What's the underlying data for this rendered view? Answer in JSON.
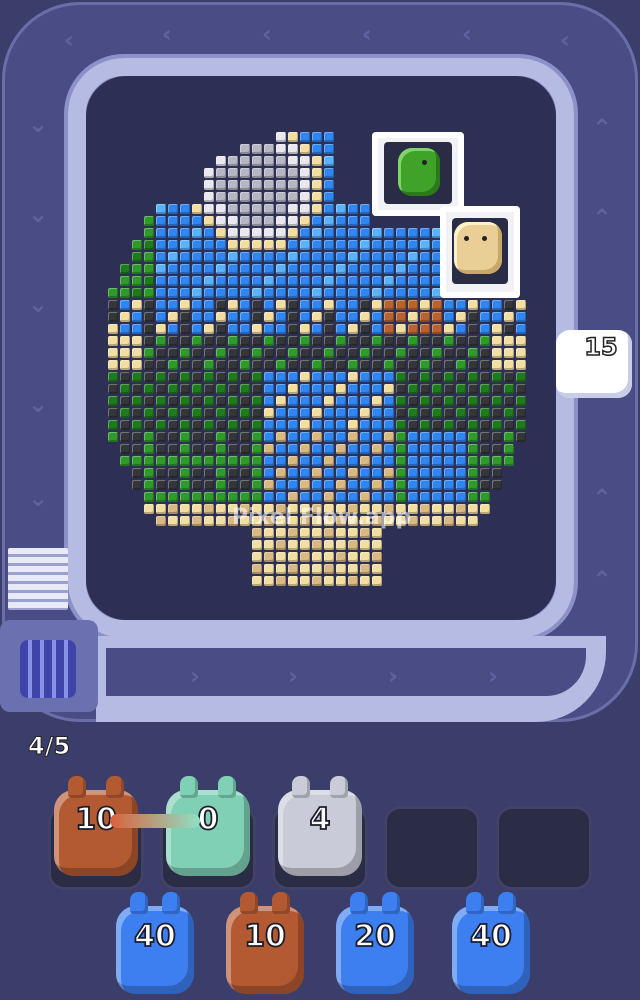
{
  "game": {
    "watermark": "Pixel Flow.app",
    "progress_text": "4/5",
    "track_shooter": {
      "value": "15",
      "color": "#ffffff"
    },
    "slots": [
      {
        "value": "10",
        "color": "#b45a32",
        "state": "filled"
      },
      {
        "value": "0",
        "color": "#7fd0b5",
        "state": "filled"
      },
      {
        "value": "4",
        "color": "#c9cbd8",
        "state": "filled"
      },
      {
        "value": "",
        "state": "empty"
      },
      {
        "value": "",
        "state": "empty"
      }
    ],
    "queue": [
      {
        "value": "40",
        "color": "#3d7ff0"
      },
      {
        "value": "10",
        "color": "#b45a32"
      },
      {
        "value": "20",
        "color": "#3d7ff0"
      },
      {
        "value": "40",
        "color": "#3d7ff0"
      }
    ],
    "palette": {
      "blue": "#2f86f0",
      "lightblue": "#5ab3ff",
      "green": "#2f9a2a",
      "darkgreen": "#1f7a1c",
      "black": "#34363a",
      "cream": "#f2dfa0",
      "tan": "#d8b980",
      "brown": "#b8632e",
      "white": "#e8e8ee",
      "grey": "#b7b7c4",
      "teal": "#5fb7a3"
    },
    "crate_critters": [
      "green-critter",
      "tan-critter"
    ]
  }
}
